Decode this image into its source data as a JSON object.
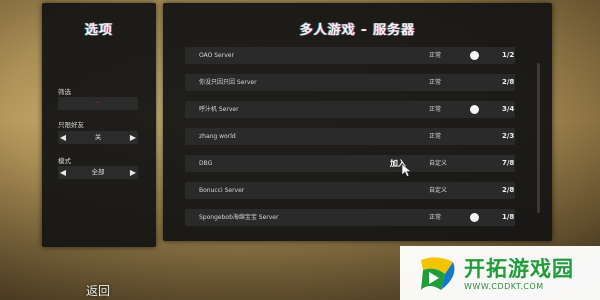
{
  "left_panel": {
    "title": "选项",
    "filter": {
      "label": "筛选",
      "value": "--"
    },
    "friends_only": {
      "label": "只限好友",
      "value": "关"
    },
    "mode": {
      "label": "模式",
      "value": "全部"
    }
  },
  "right_panel": {
    "title": "多人游戏 - 服务器",
    "servers": [
      {
        "name": "OAO Server",
        "status": "正常",
        "players": "1/2",
        "has_dot": true,
        "join_label": ""
      },
      {
        "name": "你没只因只因 Server",
        "status": "正常",
        "players": "2/8",
        "has_dot": false,
        "join_label": ""
      },
      {
        "name": "呼汁机 Server",
        "status": "正常",
        "players": "3/4",
        "has_dot": true,
        "join_label": ""
      },
      {
        "name": "zhang world",
        "status": "正常",
        "players": "2/3",
        "has_dot": false,
        "join_label": ""
      },
      {
        "name": "DBG",
        "status": "自定义",
        "players": "7/8",
        "has_dot": false,
        "join_label": "加入"
      },
      {
        "name": "Bonucci Server",
        "status": "自定义",
        "players": "2/8",
        "has_dot": false,
        "join_label": ""
      },
      {
        "name": "Spongebob海绵宝宝 Server",
        "status": "正常",
        "players": "1/8",
        "has_dot": true,
        "join_label": ""
      }
    ]
  },
  "back_button": {
    "label": "返回"
  },
  "watermark": {
    "title": "开拓游戏园",
    "url": "WWW.CDDKT.COM"
  },
  "icons": {
    "arrow_left": "◀",
    "arrow_right": "▶"
  },
  "colors": {
    "accent_green": "#1f9d3a",
    "panel_bg": "#141414",
    "row_bg": "#2a2a2a"
  }
}
